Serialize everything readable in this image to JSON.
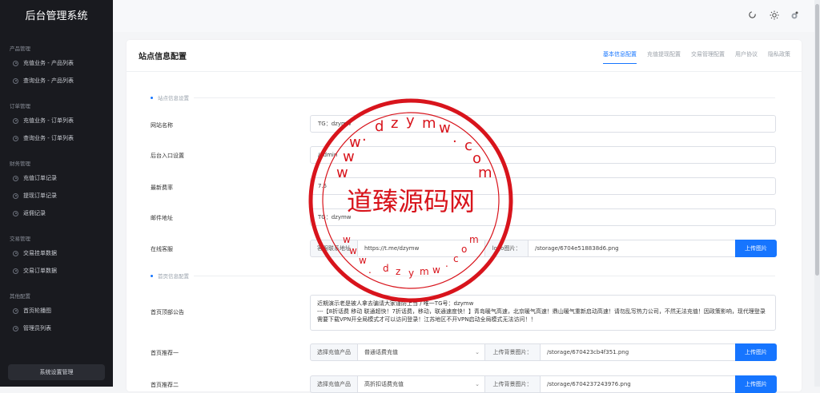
{
  "app": {
    "title": "后台管理系统"
  },
  "sidebar": {
    "groups": [
      {
        "title": "产品管理",
        "items": [
          "充值业务 - 产品列表",
          "查询业务 - 产品列表"
        ]
      },
      {
        "title": "订单管理",
        "items": [
          "充值业务 - 订单列表",
          "查询业务 - 订单列表"
        ]
      },
      {
        "title": "财务管理",
        "items": [
          "充值订单记录",
          "提现订单记录",
          "返佣记录"
        ]
      },
      {
        "title": "交易管理",
        "items": [
          "交易挂单数据",
          "交易订单数据"
        ]
      },
      {
        "title": "其他配置",
        "items": [
          "首页轮播图",
          "管理员列表"
        ]
      }
    ],
    "system_button": "系统设置管理"
  },
  "topbar": {
    "icons": [
      "refresh-icon",
      "sun-icon",
      "settings-icon"
    ]
  },
  "card": {
    "title": "站点信息配置",
    "tabs": [
      "基本信息配置",
      "充值提现配置",
      "交易管理配置",
      "用户协议",
      "隐私政策"
    ],
    "active_tab": 0
  },
  "form": {
    "section1": "站点信息设置",
    "site_name_label": "网站名称",
    "site_name_value": "TG：dzymw",
    "admin_entry_label": "后台入口设置",
    "admin_entry_value": "/admin",
    "rate_label": "最新费率",
    "rate_value": "7.5",
    "email_label": "邮件地址",
    "email_value": "TG：dzymw",
    "service_label": "在线客服",
    "service_addon": "客服联系地址",
    "service_value": "https://t.me/dzymw",
    "logo_addon": "logo图片：",
    "logo_value": "/storage/6704e518838d6.png",
    "upload_label": "上传图片",
    "section2": "首页信息配置",
    "notice_label": "首页顶部公告",
    "notice_line1": "近期演示老是被人拿去骗请大家谨防上当 / 唯一TG号：dzymw",
    "notice_line2": "---【8折话费 移动 联通超快！7折话费，移动，联通速度快！】青岛暖气高速，北京暖气高速！鼎山暖气重新启动高速！请勿乱写热力公司，不然无法充值！因政策影响，现代理登录需要下载VPN开全局模式才可以访问登录！江苏地区不开VPN启动全局模式无法访问！！",
    "rec1_label": "首页推荐一",
    "rec2_label": "首页推荐二",
    "select_product_addon": "选择充值产品",
    "rec1_product": "普通话费充值",
    "rec2_product": "高折扣话费充值",
    "bg_addon": "上传背景图片：",
    "rec1_bg": "/storage/670423cb4f351.png",
    "rec2_bg": "/storage/6704237243976.png"
  },
  "stamp": {
    "center_text": "道臻源码网",
    "ring_text": "www.dzymw.com",
    "color": "#d8141c"
  }
}
